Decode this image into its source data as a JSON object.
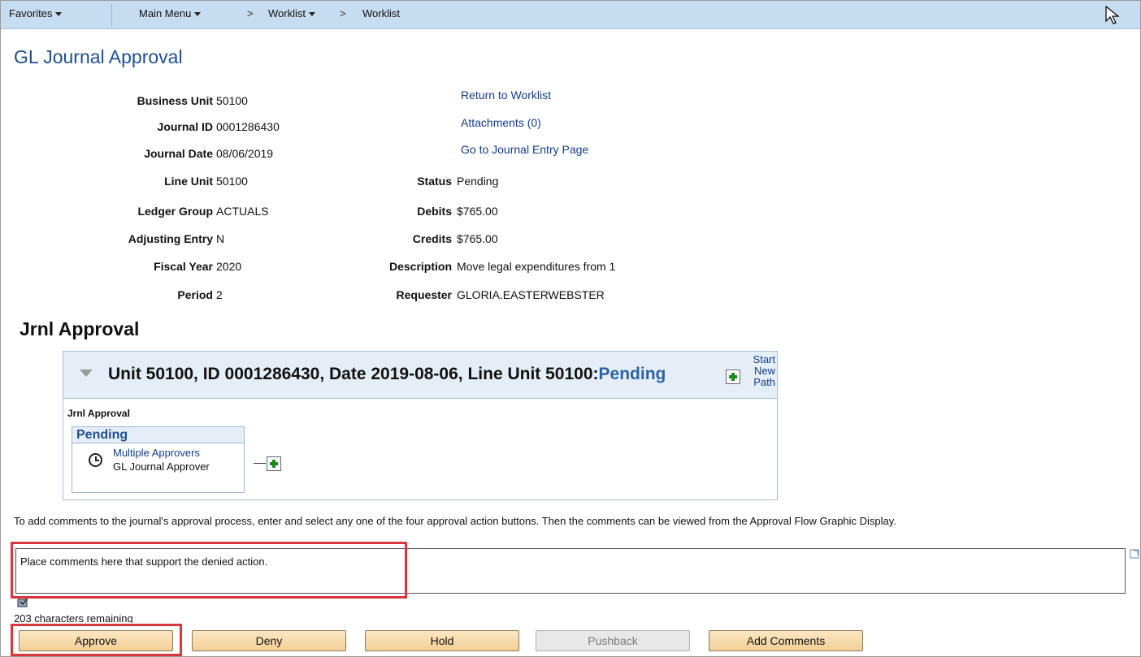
{
  "topnav": {
    "favorites": "Favorites",
    "main_menu": "Main Menu",
    "crumb_worklist": "Worklist",
    "crumb_current": "Worklist",
    "chevron": ">"
  },
  "page_title": "GL Journal Approval",
  "header_fields": [
    {
      "label": "Business Unit",
      "value": "50100"
    },
    {
      "label": "Journal ID",
      "value": "0001286430"
    },
    {
      "label": "Journal Date",
      "value": "08/06/2019"
    },
    {
      "label": "Line Unit",
      "value": "50100"
    },
    {
      "label": "Ledger Group",
      "value": "ACTUALS"
    },
    {
      "label": "Adjusting Entry",
      "value": "N"
    },
    {
      "label": "Fiscal Year",
      "value": "2020"
    },
    {
      "label": "Period",
      "value": "2"
    }
  ],
  "links": {
    "return_worklist": "Return to Worklist",
    "attachments": "Attachments (0)",
    "journal_entry": "Go to Journal Entry Page"
  },
  "right_fields": [
    {
      "label": "Status",
      "value": "Pending"
    },
    {
      "label": "Debits",
      "value": "$765.00"
    },
    {
      "label": "Credits",
      "value": "$765.00"
    },
    {
      "label": "Description",
      "value": "Move legal expenditures from 1"
    },
    {
      "label": "Requester",
      "value": "GLORIA.EASTERWEBSTER"
    }
  ],
  "section_title": "Jrnl Approval",
  "approval": {
    "header_text": "Unit 50100, ID 0001286430, Date 2019-08-06, Line Unit 50100:",
    "header_status": "Pending",
    "start_path_1": "Start",
    "start_path_2": "New",
    "start_path_3": "Path",
    "sub_title": "Jrnl Approval",
    "stage_status": "Pending",
    "stage_approver": "Multiple Approvers",
    "stage_role": "GL Journal Approver"
  },
  "instructions": "To add comments to the journal's approval process, enter and select any one of the four approval action buttons. Then the comments can be viewed from the Approval Flow Graphic Display.",
  "comment": {
    "value": "Place comments here that support the denied action."
  },
  "char_remaining": "203 characters remaining",
  "buttons": {
    "approve": "Approve",
    "deny": "Deny",
    "hold": "Hold",
    "pushback": "Pushback",
    "add_comments": "Add Comments"
  },
  "colors": {
    "nav_bg": "#c6dcf0",
    "link": "#123d8a",
    "title": "#1f4f8f",
    "highlight": "#d9363e",
    "button": "#f3cf94"
  }
}
